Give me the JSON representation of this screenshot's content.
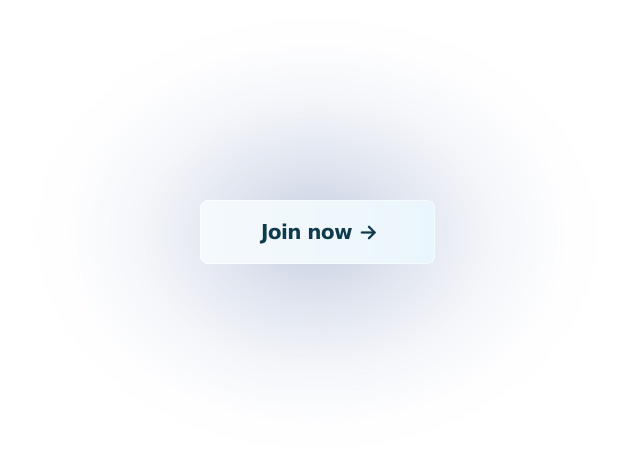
{
  "cta": {
    "label": "Join now",
    "icon": "arrow-right-icon"
  },
  "colors": {
    "text": "#0f3b4d",
    "button_bg_start": "#f5f9fd",
    "button_bg_end": "#eaf6fd",
    "glow": "#c4ccdf",
    "page_bg": "#ffffff"
  }
}
